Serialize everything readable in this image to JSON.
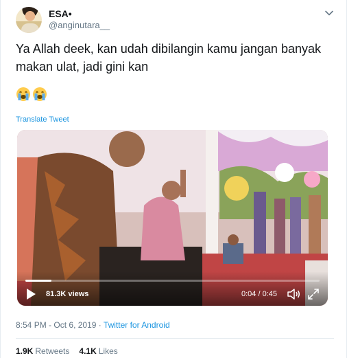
{
  "user": {
    "display_name": "ESA•",
    "handle": "@anginutara__"
  },
  "tweet": {
    "text": "Ya Allah deek, kan udah dibilangin kamu jangan banyak makan ulat, jadi gini kan",
    "emojis": [
      "crying-face",
      "crying-face"
    ],
    "translate_label": "Translate Tweet"
  },
  "video": {
    "views": "81.3K views",
    "time": "0:04 / 0:45",
    "progress": 0.089
  },
  "meta": {
    "time": "8:54 PM",
    "date": "Oct 6, 2019",
    "separator": "·",
    "source": "Twitter for Android"
  },
  "stats": {
    "retweets_count": "1.9K",
    "retweets_label": "Retweets",
    "likes_count": "4.1K",
    "likes_label": "Likes"
  },
  "colors": {
    "link": "#1b95e0",
    "secondary_text": "#657786",
    "primary_text": "#14171a"
  }
}
